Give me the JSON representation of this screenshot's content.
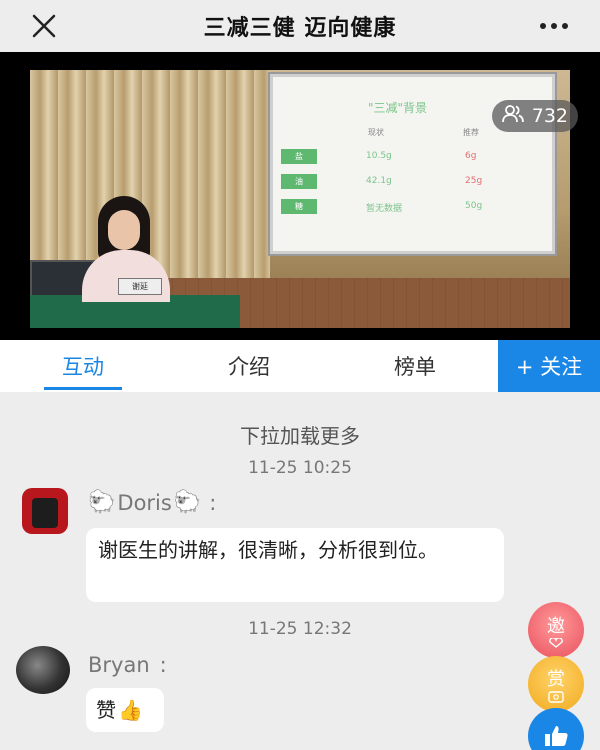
{
  "header": {
    "title": "三减三健 迈向健康",
    "close_icon": "close-icon",
    "more_icon": "more-dots-icon"
  },
  "video": {
    "viewer_count": "732",
    "viewer_icon": "people-icon",
    "slide": {
      "title": "\"三减\"背景",
      "col_current": "现状",
      "col_recommended": "推荐",
      "rows": [
        {
          "tag": "盐",
          "current": "10.5g",
          "recommended": "6g"
        },
        {
          "tag": "油",
          "current": "42.1g",
          "recommended": "25g"
        },
        {
          "tag": "糖",
          "current": "暂无数据",
          "recommended": "50g"
        }
      ]
    },
    "name_plate": "谢延"
  },
  "tabs": [
    {
      "label": "互动",
      "active": true
    },
    {
      "label": "介绍",
      "active": false
    },
    {
      "label": "榜单",
      "active": false
    }
  ],
  "follow_label": "+ 关注",
  "chat": {
    "load_more": "下拉加载更多",
    "messages": [
      {
        "timestamp": "11-25 10:25",
        "user": "Doris",
        "colon": ":",
        "sheep": "🐑",
        "text": "谢医生的讲解，很清晰，分析很到位。"
      },
      {
        "timestamp": "11-25 12:32",
        "user": "Bryan",
        "colon": ":",
        "text": "赞",
        "emoji": "👍"
      }
    ]
  },
  "fabs": {
    "invite": "邀",
    "reward": "赏",
    "like_icon": "thumbs-up-icon"
  },
  "colors": {
    "accent": "#1a86e6",
    "background": "#ededed"
  }
}
